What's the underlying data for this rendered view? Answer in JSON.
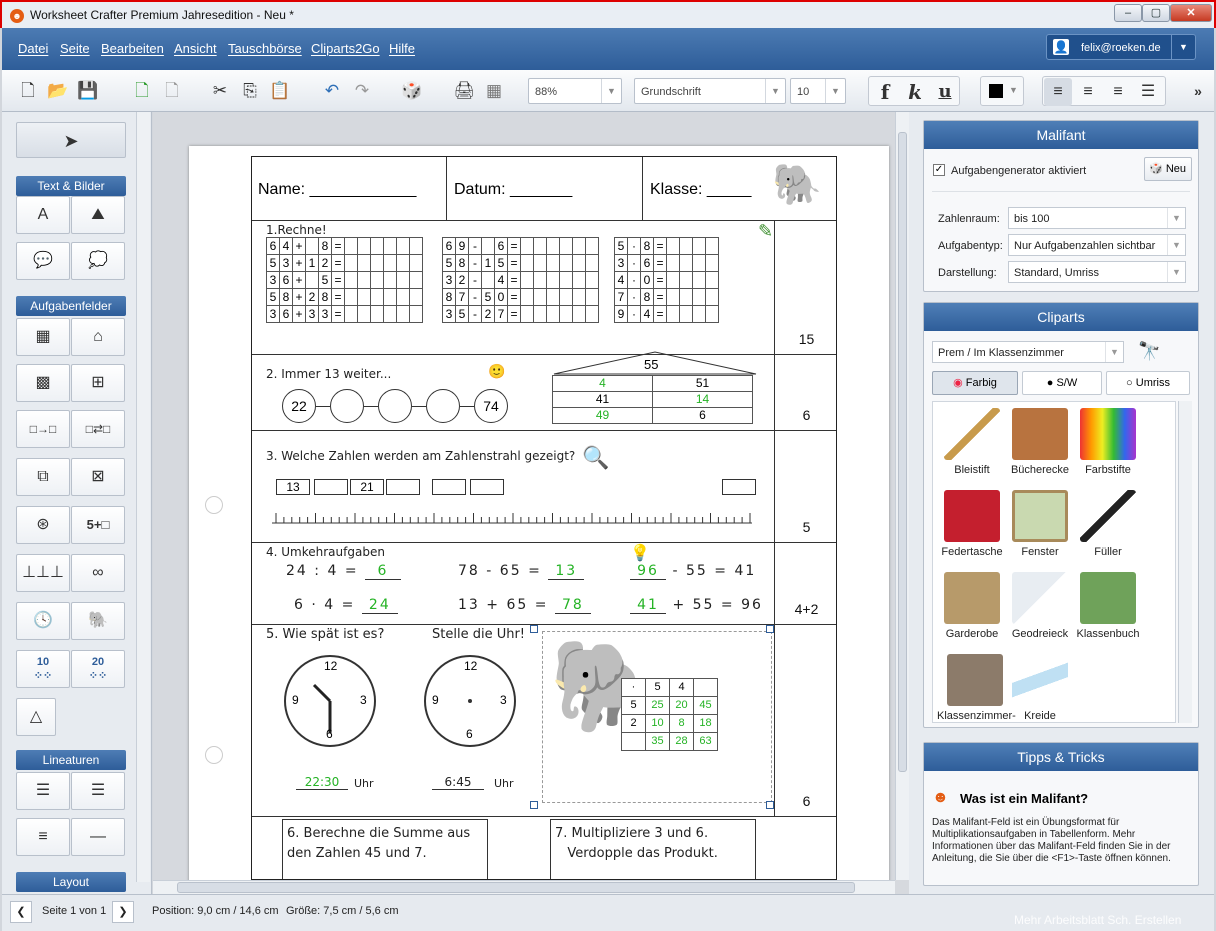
{
  "window": {
    "title": "Worksheet Crafter Premium Jahresedition - Neu *",
    "logo": "crafter-logo-icon",
    "min": "–",
    "max": "▢",
    "close": "✕"
  },
  "menu": {
    "items": [
      "Datei",
      "Seite",
      "Bearbeiten",
      "Ansicht",
      "Tauschbörse",
      "Cliparts2Go",
      "Hilfe"
    ],
    "user": "felix@roeken.de"
  },
  "toolbar": {
    "zoom": "88%",
    "font": "Grundschrift",
    "size": "10",
    "bold": "f",
    "italic": "k",
    "underline": "u",
    "more": "»"
  },
  "left": {
    "sections": [
      "Text & Bilder",
      "Aufgabenfelder",
      "Lineaturen",
      "Layout"
    ]
  },
  "sheet": {
    "name": "Name: ____________",
    "date": "Datum: _______",
    "klasse": "Klasse: _____",
    "t1": "1.Rechne!",
    "t1_pts": "15",
    "t1_rows": [
      [
        "6",
        "4",
        "+",
        "",
        "8",
        "="
      ],
      [
        "5",
        "3",
        "+",
        "1",
        "2",
        "="
      ],
      [
        "3",
        "6",
        "+",
        "",
        "5",
        "="
      ],
      [
        "5",
        "8",
        "+",
        "2",
        "8",
        "="
      ],
      [
        "3",
        "6",
        "+",
        "3",
        "3",
        "="
      ]
    ],
    "t1_rows_b": [
      [
        "6",
        "9",
        "-",
        "",
        "6",
        "="
      ],
      [
        "5",
        "8",
        "-",
        "1",
        "5",
        "="
      ],
      [
        "3",
        "2",
        "-",
        "",
        "4",
        "="
      ],
      [
        "8",
        "7",
        "-",
        "5",
        "0",
        "="
      ],
      [
        "3",
        "5",
        "-",
        "2",
        "7",
        "="
      ]
    ],
    "t1_rows_c": [
      [
        "5",
        "·",
        "8",
        "="
      ],
      [
        "3",
        "·",
        "6",
        "="
      ],
      [
        "4",
        "·",
        "0",
        "="
      ],
      [
        "7",
        "·",
        "8",
        "="
      ],
      [
        "9",
        "·",
        "4",
        "="
      ]
    ],
    "t2": "2. Immer 13 weiter...",
    "t2_pts": "6",
    "t2_start": "22",
    "t2_end": "74",
    "t2_roof": "55",
    "t2_house": [
      [
        "4",
        "51"
      ],
      [
        "41",
        "14"
      ],
      [
        "49",
        "6"
      ]
    ],
    "t3": "3. Welche Zahlen werden am Zahlenstrahl gezeigt?",
    "t3_pts": "5",
    "t3_boxes": [
      "13",
      "",
      "21",
      "",
      "",
      "",
      ""
    ],
    "t4": "4. Umkehraufgaben",
    "t4_pts": "4+2",
    "t4_l1": [
      "24",
      ":",
      "4",
      "=",
      "6"
    ],
    "t4_l2": [
      "6",
      "·",
      "4",
      "=",
      "24"
    ],
    "t4_m1": [
      "78",
      "-",
      "65",
      "=",
      "13"
    ],
    "t4_m2": [
      "13",
      "+",
      "65",
      "=",
      "78"
    ],
    "t4_r1": [
      "96",
      "-",
      "55",
      "=",
      "41"
    ],
    "t4_r2": [
      "41",
      "+",
      "55",
      "=",
      "96"
    ],
    "t5": "5. Wie spät ist es?",
    "t5b": "Stelle die Uhr!",
    "t5_pts": "6",
    "time1": "22:30",
    "time2": "6:45",
    "uhr": "Uhr",
    "malifant": [
      [
        "·",
        "5",
        "4",
        ""
      ],
      [
        "5",
        "25",
        "20",
        "45"
      ],
      [
        "2",
        "10",
        "8",
        "18"
      ],
      [
        "",
        "35",
        "28",
        "63"
      ]
    ],
    "t6": "6. Berechne die Summe aus",
    "t6b": "den Zahlen 45 und 7.",
    "t7": "7. Multipliziere 3 und 6.",
    "t7b": "Verdopple das Produkt."
  },
  "right": {
    "malifant_title": "Malifant",
    "gen_label": "Aufgabengenerator aktiviert",
    "neu": "Neu",
    "fields": [
      {
        "label": "Zahlenraum:",
        "value": "bis 100"
      },
      {
        "label": "Aufgabentyp:",
        "value": "Nur Aufgabenzahlen sichtbar"
      },
      {
        "label": "Darstellung:",
        "value": "Standard, Umriss"
      }
    ],
    "cliparts_title": "Cliparts",
    "category": "Prem / Im Klassenzimmer",
    "tabs": [
      "Farbig",
      "S/W",
      "Umriss"
    ],
    "items": [
      "Bleistift",
      "Bücherecke",
      "Farbstifte",
      "Federtasche",
      "Fenster",
      "Füller",
      "Garderobe",
      "Geodreieck",
      "Klassenbuch",
      "Klassenzimmer-PC",
      "Kreide"
    ],
    "tips_title": "Tipps & Tricks",
    "tip_heading": "Was ist ein Malifant?",
    "tip_text": "Das Malifant-Feld ist ein Übungsformat für Multiplikationsaufgaben in Tabellenform. Mehr Informationen über das Malifant-Feld finden Sie in der Anleitung, die Sie über die <F1>-Taste öffnen können."
  },
  "status": {
    "page": "Seite 1 von 1",
    "position": "Position: 9,0 cm / 14,6 cm",
    "size": "Größe: 7,5 cm / 5,6 cm",
    "watermark": "Mehr Arbeitsblatt Sch. Erstellen"
  },
  "colors": {
    "accent": "#2e5d99",
    "answer": "#25b325"
  }
}
